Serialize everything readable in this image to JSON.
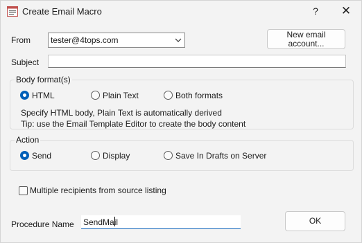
{
  "window": {
    "title": "Create Email Macro",
    "help_label": "?",
    "close_label": "✕"
  },
  "from": {
    "label": "From",
    "value": "tester@4tops.com"
  },
  "new_account_button": {
    "line1": "New email",
    "line2": "account..."
  },
  "subject": {
    "label": "Subject",
    "value": ""
  },
  "body_format": {
    "legend": "Body format(s)",
    "options": [
      "HTML",
      "Plain Text",
      "Both formats"
    ],
    "selected": "HTML",
    "hint1": "Specify HTML body, Plain Text is automatically derived",
    "hint2": "Tip: use the Email Template Editor to create the body content"
  },
  "action": {
    "legend": "Action",
    "options": [
      "Send",
      "Display",
      "Save In Drafts on Server"
    ],
    "selected": "Send"
  },
  "multiple_recipients": {
    "label": "Multiple recipients from source listing",
    "checked": false
  },
  "procedure": {
    "label": "Procedure Name",
    "value": "SendMail"
  },
  "ok_button": {
    "label": "OK"
  },
  "colors": {
    "accent": "#005fb8",
    "window_bg": "#f3f3f3"
  }
}
